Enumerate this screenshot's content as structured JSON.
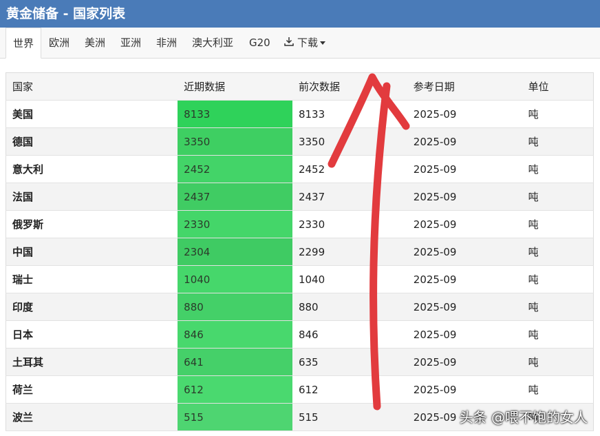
{
  "header": {
    "title": "黄金储备 - 国家列表"
  },
  "tabs": [
    {
      "label": "世界",
      "active": true
    },
    {
      "label": "欧洲"
    },
    {
      "label": "美洲"
    },
    {
      "label": "亚洲"
    },
    {
      "label": "非洲"
    },
    {
      "label": "澳大利亚"
    },
    {
      "label": "G20"
    }
  ],
  "download": {
    "label": "下载"
  },
  "table": {
    "columns": [
      "国家",
      "近期数据",
      "前次数据",
      "参考日期",
      "单位"
    ],
    "rows": [
      {
        "country": "美国",
        "recent": "8133",
        "previous": "8133",
        "date": "2025-09",
        "unit": "吨",
        "shade": "#2fd25a"
      },
      {
        "country": "德国",
        "recent": "3350",
        "previous": "3350",
        "date": "2025-09",
        "unit": "吨",
        "shade": "#3ecf62"
      },
      {
        "country": "意大利",
        "recent": "2452",
        "previous": "2452",
        "date": "2025-09",
        "unit": "吨",
        "shade": "#43d468"
      },
      {
        "country": "法国",
        "recent": "2437",
        "previous": "2437",
        "date": "2025-09",
        "unit": "吨",
        "shade": "#40cc63"
      },
      {
        "country": "俄罗斯",
        "recent": "2330",
        "previous": "2330",
        "date": "2025-09",
        "unit": "吨",
        "shade": "#44d669"
      },
      {
        "country": "中国",
        "recent": "2304",
        "previous": "2299",
        "date": "2025-09",
        "unit": "吨",
        "shade": "#3fcb63"
      },
      {
        "country": "瑞士",
        "recent": "1040",
        "previous": "1040",
        "date": "2025-09",
        "unit": "吨",
        "shade": "#46d76b"
      },
      {
        "country": "印度",
        "recent": "880",
        "previous": "880",
        "date": "2025-09",
        "unit": "吨",
        "shade": "#44d068"
      },
      {
        "country": "日本",
        "recent": "846",
        "previous": "846",
        "date": "2025-09",
        "unit": "吨",
        "shade": "#48d86d"
      },
      {
        "country": "土耳其",
        "recent": "641",
        "previous": "635",
        "date": "2025-09",
        "unit": "吨",
        "shade": "#45d069"
      },
      {
        "country": "荷兰",
        "recent": "612",
        "previous": "612",
        "date": "2025-09",
        "unit": "吨",
        "shade": "#4ad96f"
      },
      {
        "country": "波兰",
        "recent": "515",
        "previous": "515",
        "date": "2025-09",
        "unit": "吨",
        "shade": "#4ed571"
      }
    ]
  },
  "watermark": "头条 @喂不饱的女人"
}
